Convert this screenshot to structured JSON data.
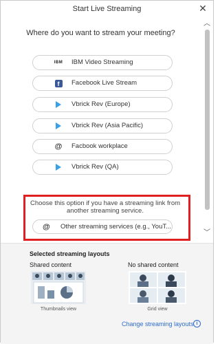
{
  "window": {
    "title": "Start Live Streaming"
  },
  "prompt": "Where do you want to stream your meeting?",
  "options": [
    {
      "label": "IBM Video Streaming",
      "icon": "ibm-icon"
    },
    {
      "label": "Facebook Live Stream",
      "icon": "facebook-icon"
    },
    {
      "label": "Vbrick Rev (Europe)",
      "icon": "play-icon"
    },
    {
      "label": "Vbrick Rev (Asia Pacific)",
      "icon": "play-icon"
    },
    {
      "label": "Facbook workplace",
      "icon": "at-icon"
    },
    {
      "label": "Vbrick Rev (QA)",
      "icon": "play-icon"
    }
  ],
  "other": {
    "description": "Choose this option if you have a streaming link from another streaming service.",
    "label": "Other streaming services (e.g., YouT..."
  },
  "layouts": {
    "title": "Selected streaming layouts",
    "shared_title": "Shared content",
    "noshared_title": "No shared content",
    "thumb_caption": "Thumbnails view",
    "grid_caption": "Grid view",
    "change_link": "Change streaming layouts"
  },
  "colors": {
    "highlight": "#e02020",
    "link": "#2d6bd1",
    "facebook": "#3b5998",
    "vbrick": "#3ba0e6"
  }
}
